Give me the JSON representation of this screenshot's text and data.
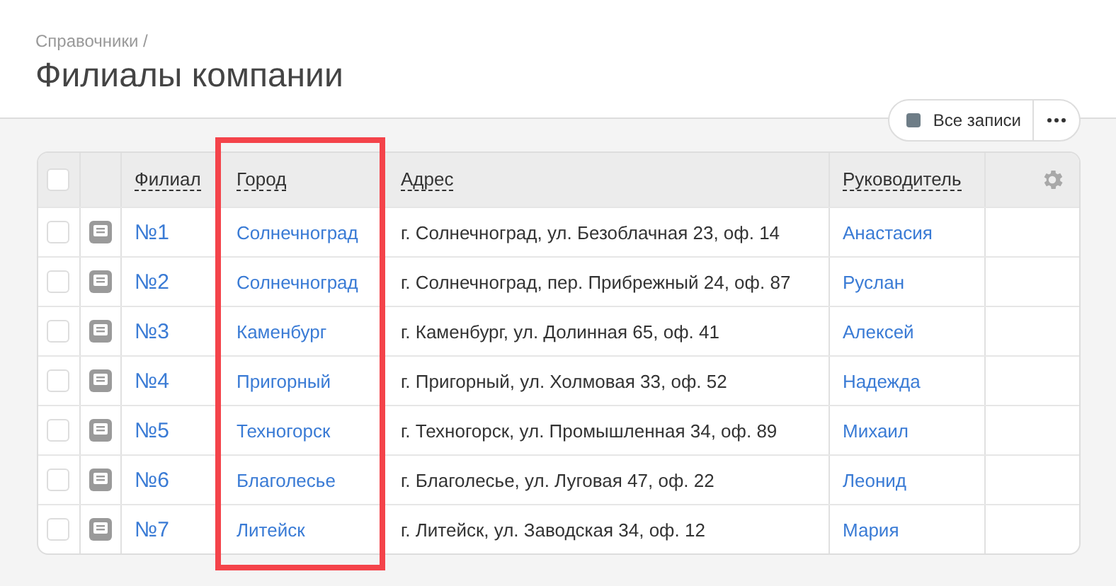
{
  "breadcrumb": "Справочники /",
  "title": "Филиалы компании",
  "filter": {
    "label": "Все записи"
  },
  "table": {
    "columns": [
      "Филиал",
      "Город",
      "Адрес",
      "Руководитель"
    ],
    "rows": [
      {
        "checked": false,
        "branch": "№1",
        "city": "Солнечноград",
        "address": "г. Солнечноград, ул. Безоблачная 23, оф. 14",
        "manager": "Анастасия"
      },
      {
        "checked": false,
        "branch": "№2",
        "city": "Солнечноград",
        "address": "г. Солнечноград, пер. Прибрежный 24, оф. 87",
        "manager": "Руслан"
      },
      {
        "checked": false,
        "branch": "№3",
        "city": "Каменбург",
        "address": "г. Каменбург, ул. Долинная 65, оф. 41",
        "manager": "Алексей"
      },
      {
        "checked": false,
        "branch": "№4",
        "city": "Пригорный",
        "address": "г. Пригорный, ул. Холмовая 33, оф. 52",
        "manager": "Надежда"
      },
      {
        "checked": false,
        "branch": "№5",
        "city": "Техногорск",
        "address": "г. Техногорск, ул. Промышленная 34, оф. 89",
        "manager": "Михаил"
      },
      {
        "checked": false,
        "branch": "№6",
        "city": "Благолесье",
        "address": "г. Благолесье, ул. Луговая 47, оф. 22",
        "manager": "Леонид"
      },
      {
        "checked": false,
        "branch": "№7",
        "city": "Литейск",
        "address": "г. Литейск, ул. Заводская 34, оф. 12",
        "manager": "Мария"
      }
    ]
  },
  "select_all_checked": false,
  "city_column_highlighted": true
}
